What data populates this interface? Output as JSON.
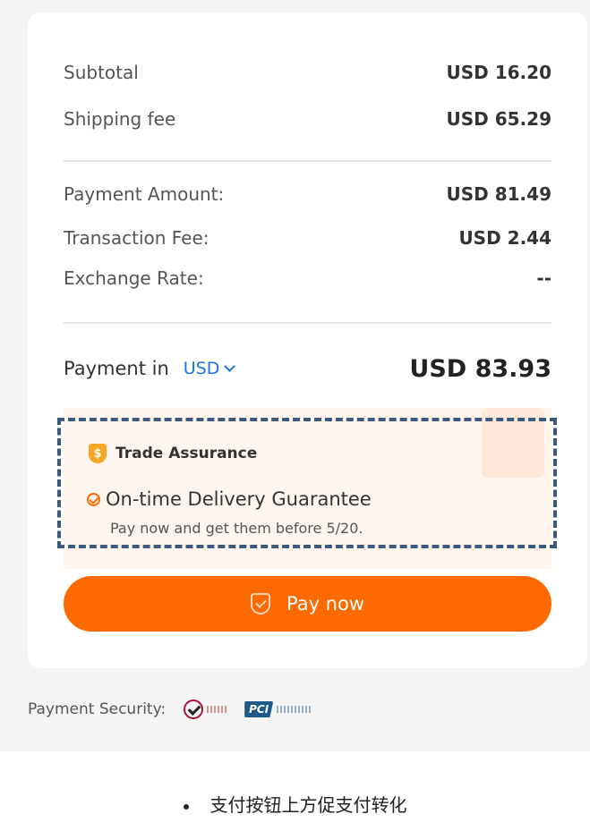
{
  "summary": {
    "rows_top": [
      {
        "label": "Subtotal",
        "value": "USD 16.20"
      },
      {
        "label": "Shipping fee",
        "value": "USD 65.29"
      }
    ],
    "rows_mid": [
      {
        "label": "Payment Amount:",
        "value": "USD 81.49"
      },
      {
        "label": "Transaction Fee:",
        "value": "USD 2.44"
      },
      {
        "label": "Exchange Rate:",
        "value": "--"
      }
    ],
    "payment_in_label": "Payment in",
    "currency": "USD",
    "total": "USD 83.93"
  },
  "assurance": {
    "badge_icon": "shield-dollar-icon",
    "badge_char": "$",
    "title": "Trade Assurance",
    "guarantee_title": "On-time Delivery Guarantee",
    "guarantee_sub": "Pay now and get them before 5/20."
  },
  "pay_button": {
    "label": "Pay now",
    "icon": "shield-check-icon"
  },
  "security": {
    "label": "Payment Security:",
    "pci_text": "PCI"
  },
  "caption": "支付按钮上方促支付转化",
  "colors": {
    "accent": "#ff6a00",
    "link": "#1a73e8",
    "dashed_frame": "#3b5a7e",
    "assurance_bg": "#fff5ef",
    "panel_bg": "#f4f4f4"
  }
}
